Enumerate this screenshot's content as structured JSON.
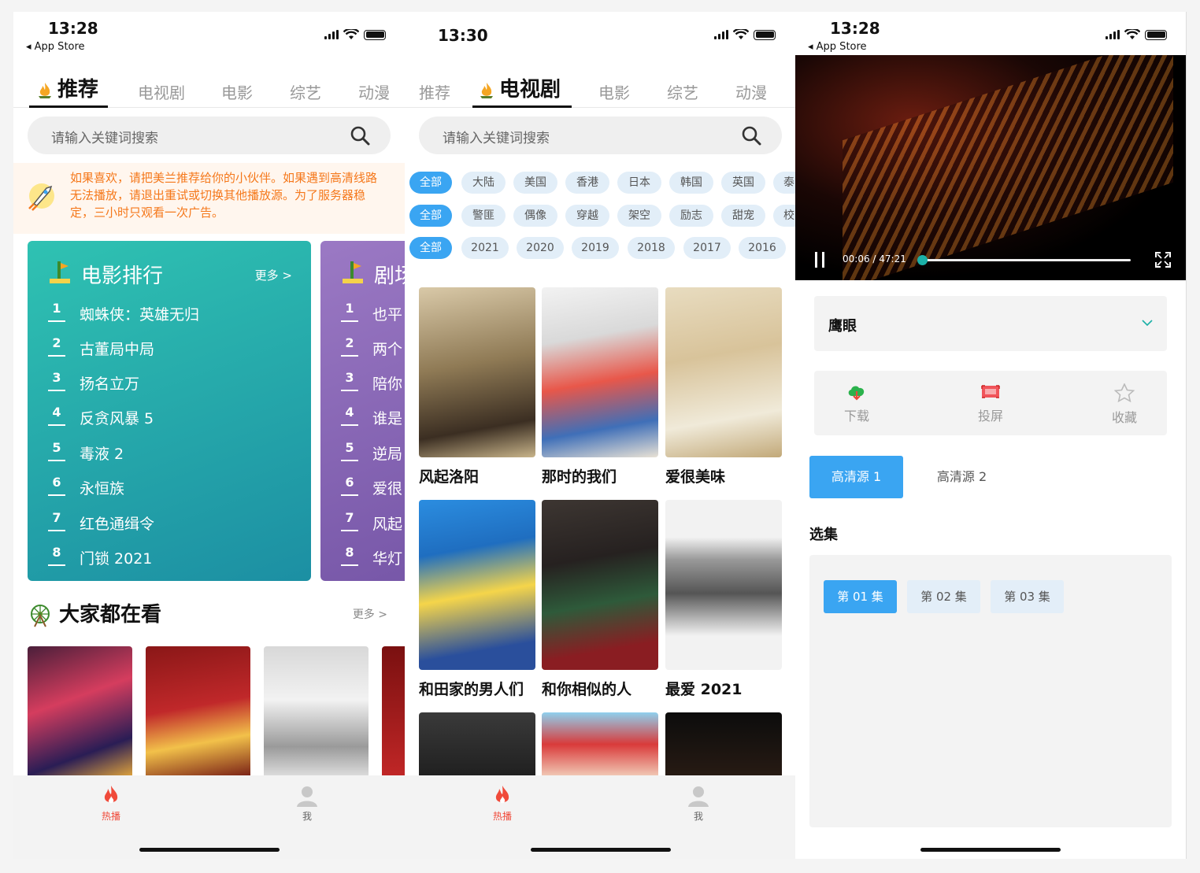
{
  "screen1": {
    "time": "13:28",
    "back": "◂ App Store",
    "tabs": [
      "推荐",
      "电视剧",
      "电影",
      "综艺",
      "动漫"
    ],
    "search_placeholder": "请输入关键词搜索",
    "notice": "如果喜欢，请把美兰推荐给你的小伙伴。如果遇到高清线路无法播放，请退出重试或切换其他播放源。为了服务器稳定，三小时只观看一次广告。",
    "rank_movie": {
      "title": "电影排行",
      "more": "更多 >",
      "items": [
        {
          "num": "1",
          "name": "蜘蛛侠：英雄无归"
        },
        {
          "num": "2",
          "name": "古董局中局"
        },
        {
          "num": "3",
          "name": "扬名立万"
        },
        {
          "num": "4",
          "name": "反贪风暴 5"
        },
        {
          "num": "5",
          "name": "毒液 2"
        },
        {
          "num": "6",
          "name": "永恒族"
        },
        {
          "num": "7",
          "name": "红色通缉令"
        },
        {
          "num": "8",
          "name": "门锁 2021"
        }
      ]
    },
    "rank_drama": {
      "title": "剧场",
      "items": [
        {
          "num": "1",
          "name": "也平"
        },
        {
          "num": "2",
          "name": "两个"
        },
        {
          "num": "3",
          "name": "陪你"
        },
        {
          "num": "4",
          "name": "谁是"
        },
        {
          "num": "5",
          "name": "逆局"
        },
        {
          "num": "6",
          "name": "爱很"
        },
        {
          "num": "7",
          "name": "风起"
        },
        {
          "num": "8",
          "name": "华灯"
        }
      ]
    },
    "popular": {
      "title": "大家都在看",
      "more": "更多 >"
    },
    "nav": {
      "hot": "热播",
      "me": "我"
    }
  },
  "screen2": {
    "time": "13:30",
    "tabs": [
      "推荐",
      "电视剧",
      "电影",
      "综艺",
      "动漫"
    ],
    "search_placeholder": "请输入关键词搜索",
    "regions": [
      "全部",
      "大陆",
      "美国",
      "香港",
      "日本",
      "韩国",
      "英国",
      "泰"
    ],
    "genres": [
      "全部",
      "警匪",
      "偶像",
      "穿越",
      "架空",
      "励志",
      "甜宠",
      "校"
    ],
    "years": [
      "全部",
      "2021",
      "2020",
      "2019",
      "2018",
      "2017",
      "2016"
    ],
    "shows": [
      {
        "title": "风起洛阳"
      },
      {
        "title": "那时的我们"
      },
      {
        "title": "爱很美味"
      },
      {
        "title": "和田家的男人们"
      },
      {
        "title": "和你相似的人"
      },
      {
        "title": "最爱 2021"
      }
    ],
    "nav": {
      "hot": "热播",
      "me": "我"
    }
  },
  "screen3": {
    "time": "13:28",
    "back": "◂ App Store",
    "video": {
      "position": "00:06",
      "duration": "47:21",
      "progress": 0.002
    },
    "title": "鹰眼",
    "actions": [
      {
        "label": "下载",
        "icon": "cloud-download-icon"
      },
      {
        "label": "投屏",
        "icon": "cast-screen-icon"
      },
      {
        "label": "收藏",
        "icon": "star-icon"
      }
    ],
    "sources": [
      "高清源 1",
      "高清源 2"
    ],
    "episodes_title": "选集",
    "episodes": [
      "第 01 集",
      "第 02 集",
      "第 03 集"
    ]
  },
  "colors": {
    "accent_blue": "#3aa5f2",
    "notice_orange": "#f5781b",
    "fire_red": "#f04a3a"
  }
}
